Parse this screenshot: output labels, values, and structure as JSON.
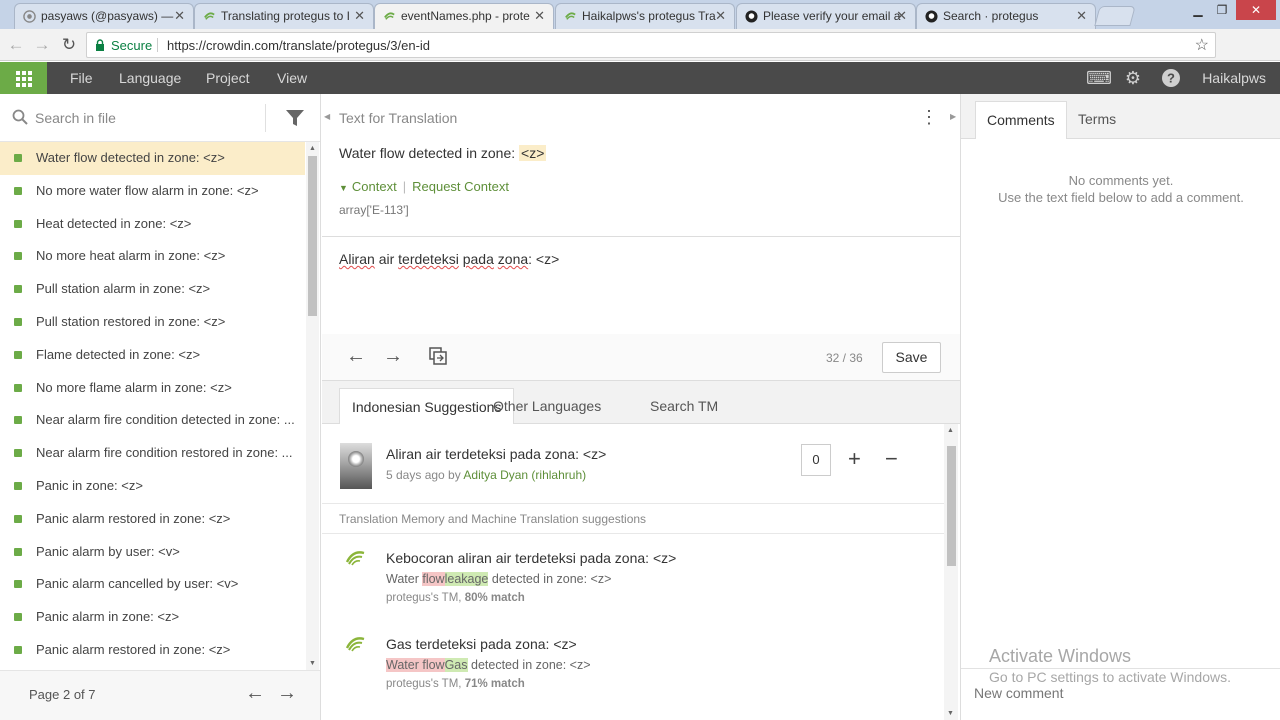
{
  "browser": {
    "tabs": [
      {
        "title": "pasyaws (@pasyaws) — "
      },
      {
        "title": "Translating protegus to I"
      },
      {
        "title": "eventNames.php - prote"
      },
      {
        "title": "Haikalpws's protegus Tra"
      },
      {
        "title": "Please verify your email a"
      },
      {
        "title": "Search · protegus"
      }
    ],
    "secure_label": "Secure",
    "url": "https://crowdin.com/translate/protegus/3/en-id"
  },
  "menubar": {
    "items": [
      "File",
      "Language",
      "Project",
      "View"
    ],
    "user": "Haikalpws"
  },
  "left": {
    "search_placeholder": "Search in file",
    "strings": [
      "Water flow detected in zone: <z>",
      "No more water flow alarm in zone: <z>",
      "Heat detected in zone: <z>",
      "No more heat alarm in zone: <z>",
      "Pull station alarm in zone: <z>",
      "Pull station restored in zone: <z>",
      "Flame detected in zone: <z>",
      "No more flame alarm in zone: <z>",
      "Near alarm fire condition detected in zone: ...",
      "Near alarm fire condition restored in zone: ...",
      "Panic in zone: <z>",
      "Panic alarm restored in zone: <z>",
      "Panic alarm by user: <v>",
      "Panic alarm cancelled by user: <v>",
      "Panic alarm in zone: <z>",
      "Panic alarm restored in zone: <z>"
    ],
    "pager": "Page 2 of 7"
  },
  "source": {
    "heading": "Text for Translation",
    "text": "Water flow detected in zone: ",
    "placeholder": "<z>",
    "context_label": "Context",
    "request_context": "Request Context",
    "context_value": "array['E-113']"
  },
  "editor": {
    "words": [
      "Aliran",
      "air",
      "terdeteksi",
      "pada",
      "zona",
      ": <z>"
    ],
    "counter": "32 / 36",
    "save_label": "Save"
  },
  "suggestions": {
    "tabs": [
      "Indonesian Suggestions",
      "Other Languages",
      "Search TM"
    ],
    "top": {
      "text": "Aliran air terdeteksi pada zona: <z>",
      "meta_prefix": "5 days ago by ",
      "author": "Aditya Dyan (rihlahruh)",
      "votes": "0"
    },
    "tm_heading": "Translation Memory and Machine Translation suggestions",
    "tm": [
      {
        "text": "Kebocoran aliran air terdeteksi pada zona: <z>",
        "src_pre": "Water ",
        "src_del": "flow",
        "src_ins": "leakage",
        "src_post": " detected in zone: <z>",
        "source_name": "protegus's TM, ",
        "match": "80% match"
      },
      {
        "text": "Gas terdeteksi pada zona: <z>",
        "src_pre": "",
        "src_del": "Water flow",
        "src_ins": "Gas",
        "src_post": " detected in zone: <z>",
        "source_name": "protegus's TM, ",
        "match": "71% match"
      }
    ]
  },
  "right": {
    "tabs": [
      "Comments",
      "Terms"
    ],
    "no_comments": "No comments yet.",
    "hint": "Use the text field below to add a comment.",
    "activate_title": "Activate Windows",
    "activate_sub": "Go to PC settings to activate Windows.",
    "new_comment": "New comment"
  },
  "colors": {
    "accent_green": "#6cab47",
    "menubar_bg": "#4a4a4a",
    "selected_row": "#fbedc9"
  }
}
